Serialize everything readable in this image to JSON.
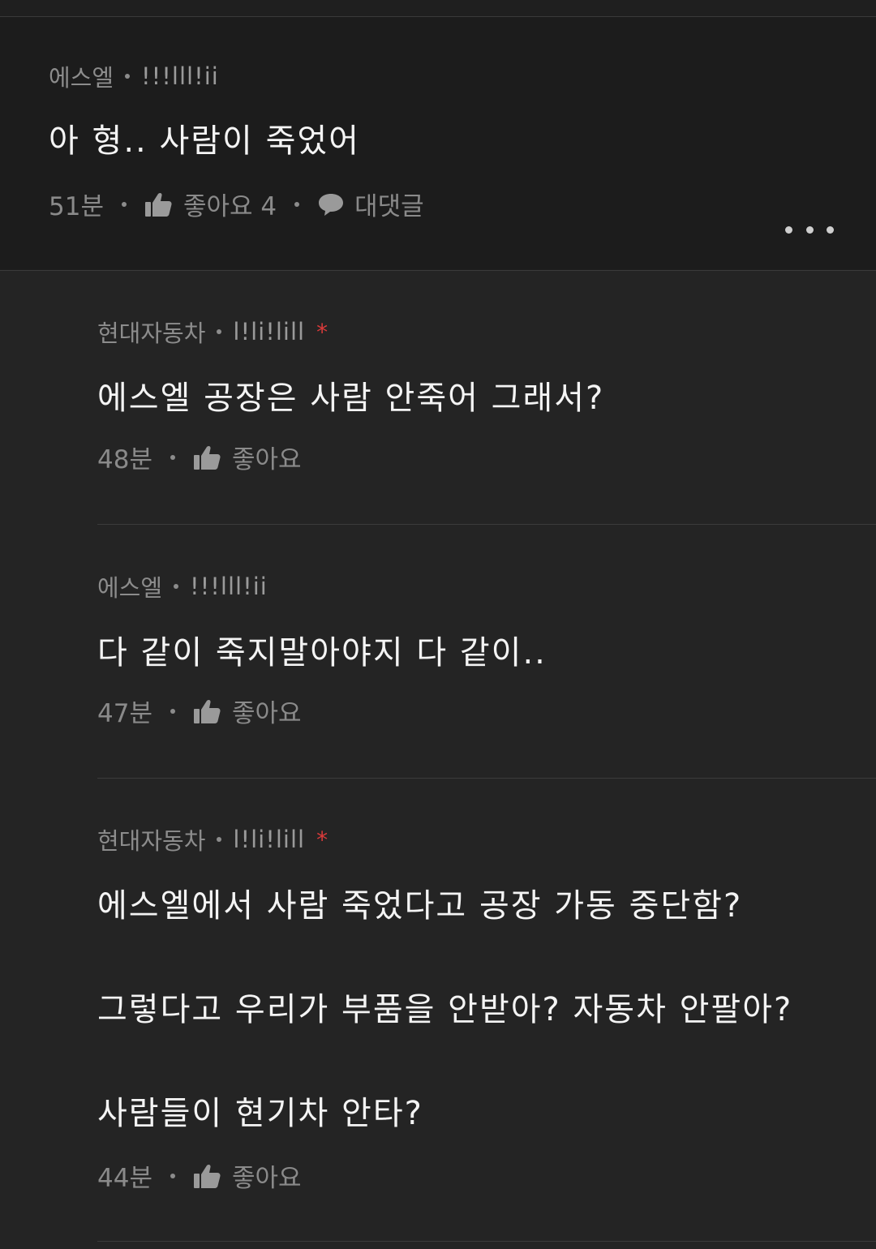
{
  "comments": [
    {
      "author": "에스엘",
      "handle": "!!!lll!ii",
      "text": "아 형.. 사람이 죽었어",
      "time": "51분",
      "like_label": "좋아요 4",
      "reply_label": "대댓글"
    }
  ],
  "replies": [
    {
      "author": "현대자동차",
      "handle": "l!li!lill",
      "text": [
        "에스엘 공장은 사람 안죽어 그래서?"
      ],
      "time": "48분",
      "like_label": "좋아요"
    },
    {
      "author": "에스엘",
      "handle": "!!!lll!ii",
      "text": [
        "다 같이 죽지말아야지 다 같이.."
      ],
      "time": "47분",
      "like_label": "좋아요"
    },
    {
      "author": "현대자동차",
      "handle": "l!li!lill",
      "text": [
        "에스엘에서 사람 죽었다고 공장 가동 중단함?",
        "그렇다고 우리가 부품을 안받아? 자동차 안팔아?",
        "사람들이 현기차 안타?"
      ],
      "time": "44분",
      "like_label": "좋아요"
    }
  ],
  "badge": "*",
  "icons": {
    "like": "thumbs-up-icon",
    "reply": "speech-bubble-icon",
    "more": "more-dots-icon"
  },
  "colors": {
    "background_main": "#1c1c1c",
    "background_replies": "#242424",
    "text_primary": "#f4f4f4",
    "text_secondary": "#8c8c8c",
    "badge": "#d93a3a"
  }
}
